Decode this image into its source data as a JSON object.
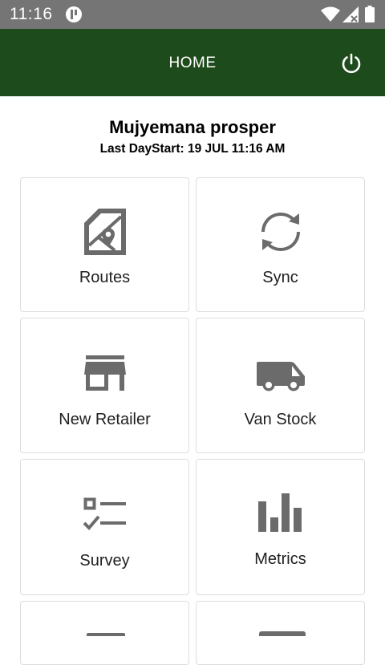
{
  "status_bar": {
    "time": "11:16",
    "app_icon": "notification-app-icon",
    "wifi_icon": "wifi-icon",
    "signal_icon": "signal-icon",
    "battery_icon": "battery-icon"
  },
  "header": {
    "title": "HOME",
    "power_icon": "power-icon",
    "background": "#1e4b1c"
  },
  "user": {
    "name": "Mujyemana prosper",
    "last_daystart": "Last DayStart: 19 JUL 11:16 AM"
  },
  "tiles": [
    {
      "label": "Routes",
      "icon": "map-icon"
    },
    {
      "label": "Sync",
      "icon": "sync-icon"
    },
    {
      "label": "New Retailer",
      "icon": "store-icon"
    },
    {
      "label": "Van Stock",
      "icon": "van-icon"
    },
    {
      "label": "Survey",
      "icon": "checklist-icon"
    },
    {
      "label": "Metrics",
      "icon": "bar-chart-icon"
    }
  ],
  "colors": {
    "icon": "#6b6b6b",
    "tile_border": "#dddddd"
  }
}
